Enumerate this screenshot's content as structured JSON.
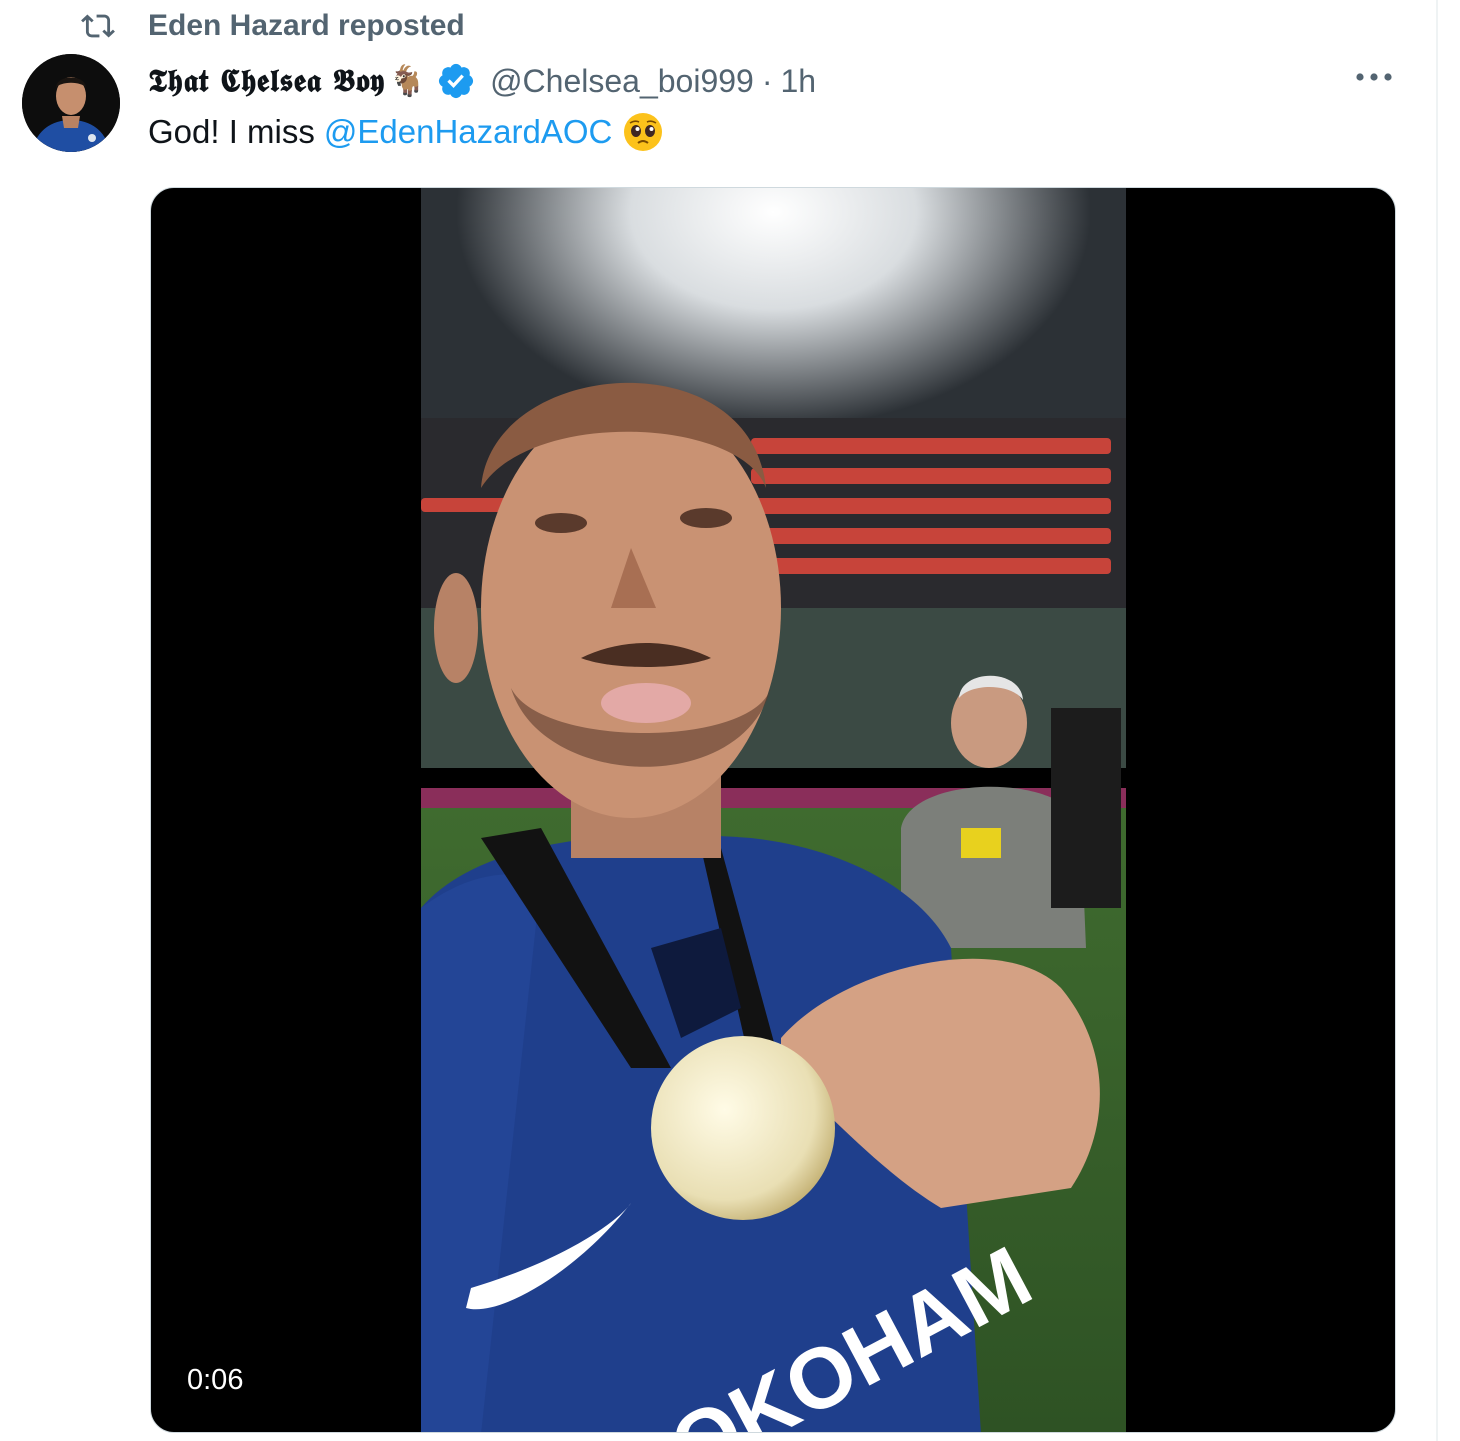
{
  "repost": {
    "text": "Eden Hazard reposted",
    "icon": "repost-icon"
  },
  "tweet": {
    "display_name": "𝕿𝖍𝖆𝖙 𝕮𝖍𝖊𝖑𝖘𝖊𝖆 𝕭𝖔𝖞",
    "name_emoji": "🐐",
    "handle": "@Chelsea_boi999",
    "separator": "·",
    "time": "1h",
    "text_prefix": "God! I miss",
    "mention": "@EdenHazardAOC",
    "emoji": "pleading-face",
    "more_icon": "more-icon",
    "verified_icon": "verified-badge-icon"
  },
  "media": {
    "type": "video",
    "duration": "0:06"
  },
  "colors": {
    "text": "#0f1419",
    "secondary": "#536471",
    "link": "#1d9bf0",
    "verified": "#1d9bf0",
    "media_bg": "#000000"
  }
}
